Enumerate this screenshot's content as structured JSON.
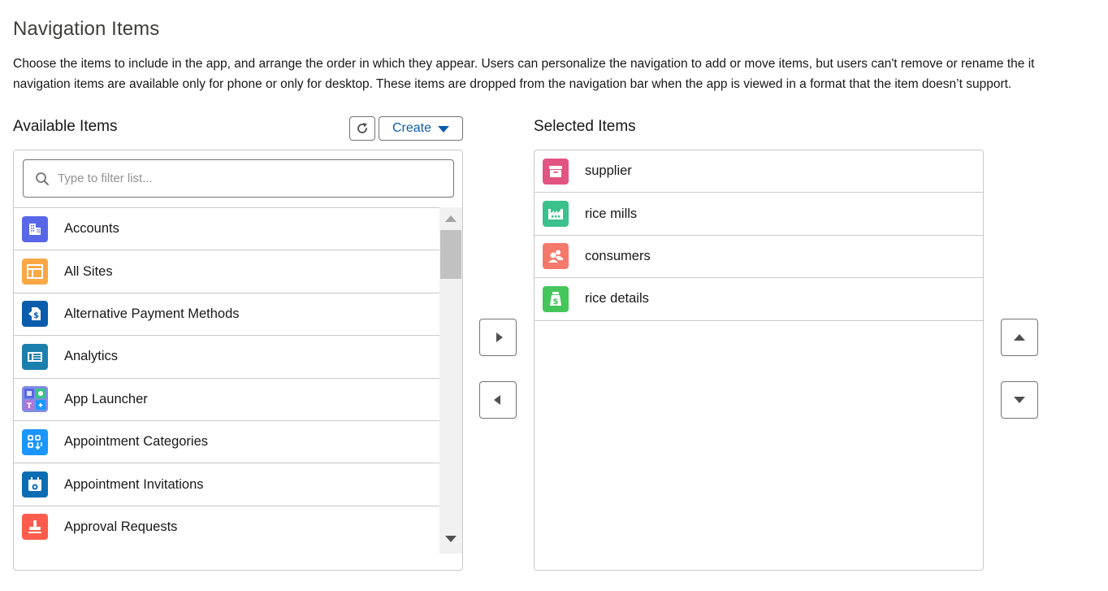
{
  "page": {
    "title": "Navigation Items",
    "description_line1": "Choose the items to include in the app, and arrange the order in which they appear. Users can personalize the navigation to add or move items, but users can't remove or rename the it",
    "description_line2": "navigation items are available only for phone or only for desktop. These items are dropped from the navigation bar when the app is viewed in a format that the item doesn’t support."
  },
  "available": {
    "label": "Available Items",
    "create_label": "Create",
    "search_placeholder": "Type to filter list...",
    "items": [
      {
        "label": "Accounts",
        "icon": "accounts-icon",
        "color": "#5867e8"
      },
      {
        "label": "All Sites",
        "icon": "sites-icon",
        "color": "#f9a845"
      },
      {
        "label": "Alternative Payment Methods",
        "icon": "payment-methods-icon",
        "color": "#0b5cab"
      },
      {
        "label": "Analytics",
        "icon": "analytics-icon",
        "color": "#1b7fad"
      },
      {
        "label": "App Launcher",
        "icon": "app-launcher-icon",
        "color": "#7f8de1"
      },
      {
        "label": "Appointment Categories",
        "icon": "appointment-categories-icon",
        "color": "#1b96ff"
      },
      {
        "label": "Appointment Invitations",
        "icon": "appointment-invitations-icon",
        "color": "#0b6db3"
      },
      {
        "label": "Approval Requests",
        "icon": "approval-requests-icon",
        "color": "#fe5c4c"
      }
    ]
  },
  "selected": {
    "label": "Selected Items",
    "items": [
      {
        "label": "supplier",
        "icon": "archive-icon",
        "color": "#e25583"
      },
      {
        "label": "rice mills",
        "icon": "factory-icon",
        "color": "#3bc18b"
      },
      {
        "label": "consumers",
        "icon": "people-icon",
        "color": "#f4796b"
      },
      {
        "label": "rice details",
        "icon": "money-bag-icon",
        "color": "#45c65a"
      }
    ]
  }
}
